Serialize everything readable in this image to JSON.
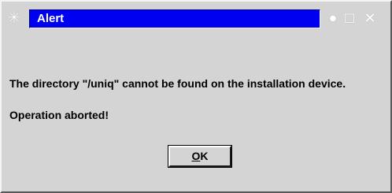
{
  "window": {
    "title": "Alert",
    "title_color": "#0000f0",
    "menu_icon": "asterisk-menu-icon",
    "controls": {
      "minimize": "minimize-icon",
      "maximize": "maximize-icon",
      "close": "close-icon"
    }
  },
  "dialog": {
    "message_line1": "The directory \"/uniq\" cannot be found on the installation device.",
    "message_line2": "Operation aborted!",
    "ok_mnemonic": "O",
    "ok_rest": "K"
  }
}
